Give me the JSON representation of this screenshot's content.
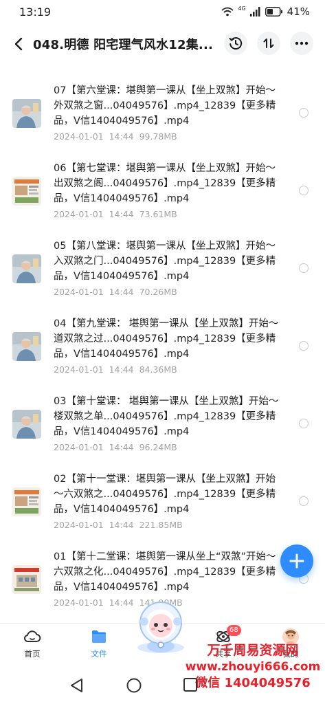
{
  "status_bar": {
    "time": "13:19",
    "network": "4G",
    "battery": "41%"
  },
  "header": {
    "title": "048.明德 阳宅理气风水12集..."
  },
  "files": [
    {
      "name": "07【第六堂课：堪舆第一课从【坐上双煞】开始～外双煞之窗...04049576】.mp4_12839【更多精品，V信1404049576】.mp4",
      "date": "2024-01-01",
      "time": "14:44",
      "size": "99.78MB",
      "thumb": "person"
    },
    {
      "name": "06【第七堂课：堪舆第一课从【坐上双煞】开始～出双煞之阁...04049576】.mp4_12839【更多精品，V信1404049576】.mp4",
      "date": "2024-01-01",
      "time": "14:44",
      "size": "73.61MB",
      "thumb": "slide"
    },
    {
      "name": "05【第八堂课：堪舆第一课从【坐上双煞】开始～入双煞之门...04049576】.mp4_12839【更多精品，V信1404049576】.mp4",
      "date": "2024-01-01",
      "time": "14:44",
      "size": "70.26MB",
      "thumb": "person"
    },
    {
      "name": "04【第九堂课： 堪舆第一课从【坐上双煞】开始～道双煞之过...04049576】.mp4_12839【更多精品，V信1404049576】.mp4",
      "date": "2024-01-01",
      "time": "14:44",
      "size": "84.36MB",
      "thumb": "person"
    },
    {
      "name": "03【第十堂课： 堪舆第一课从【坐上双煞】开始～楼双煞之单...04049576】.mp4_12839【更多精品，V信1404049576】.mp4",
      "date": "2024-01-01",
      "time": "14:44",
      "size": "96.24MB",
      "thumb": "person"
    },
    {
      "name": "02【第十一堂课：堪舆第一课从【坐上双煞】开始～六双煞之...04049576】.mp4_12839【更多精品，V信1404049576】.mp4",
      "date": "2024-01-01",
      "time": "14:44",
      "size": "221.85MB",
      "thumb": "slide"
    },
    {
      "name": "01【第十二堂课：堪舆第一课从坐上“双煞”开始～六双煞之化...04049576】.mp4_12839【更多精品，V信1404049576】.mp4",
      "date": "2024-01-01",
      "time": "14:44",
      "size": "141.90MB",
      "thumb": "building"
    }
  ],
  "tabs": [
    {
      "label": "首页",
      "icon": "cloud-home-icon"
    },
    {
      "label": "文件",
      "icon": "folder-icon"
    },
    {
      "label": "共享",
      "icon": "share-orbit-icon",
      "badge": "68"
    },
    {
      "label": "我的",
      "icon": "avatar-icon"
    }
  ],
  "watermark": {
    "line1": "万千周易资源网",
    "line2": "www.zhouyi666.com",
    "line3": "微信 1404049576"
  },
  "colors": {
    "accent": "#2f8cff",
    "badge": "#ff4d5a",
    "watermark": "#e8202a"
  }
}
